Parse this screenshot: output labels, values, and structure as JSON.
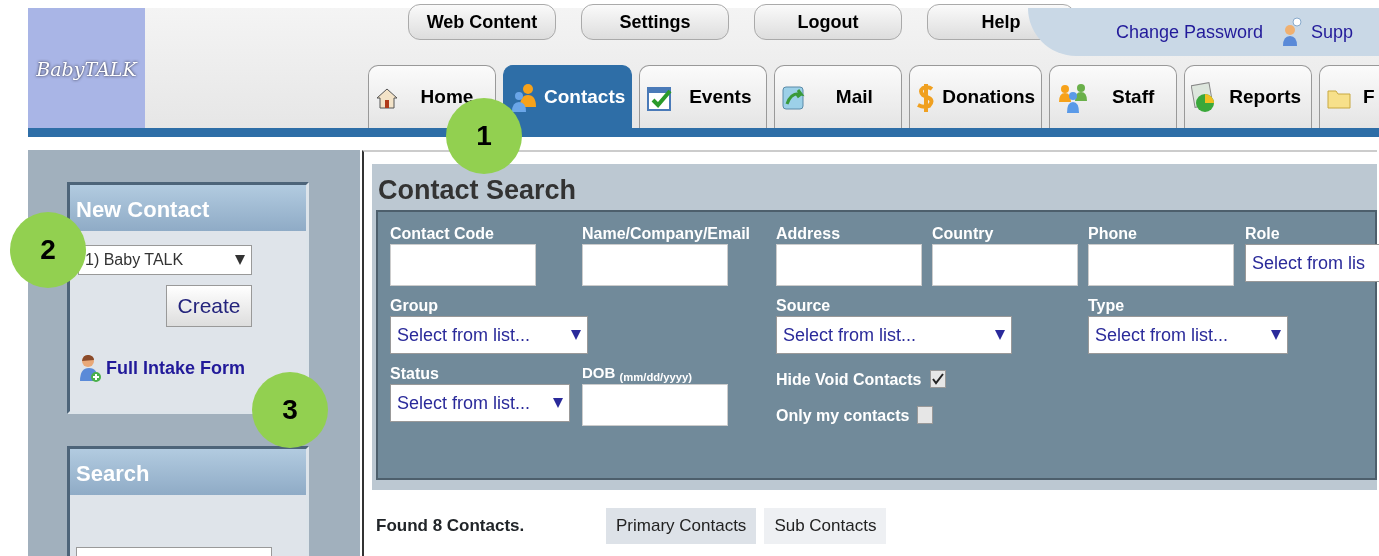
{
  "logo": {
    "text": "BabyTALK"
  },
  "top_buttons": [
    "Web Content",
    "Settings",
    "Logout",
    "Help"
  ],
  "account_links": [
    {
      "label": "Change Password",
      "kind": "link"
    },
    {
      "label": "Supp",
      "kind": "support"
    }
  ],
  "tabs": [
    {
      "label": "Home",
      "kind": "home",
      "selected": false
    },
    {
      "label": "Contacts",
      "kind": "people",
      "selected": true
    },
    {
      "label": "Events",
      "kind": "calendar",
      "selected": false
    },
    {
      "label": "Mail",
      "kind": "mail",
      "selected": false
    },
    {
      "label": "Donations",
      "kind": "dollar",
      "selected": false
    },
    {
      "label": "Staff",
      "kind": "staff",
      "selected": false
    },
    {
      "label": "Reports",
      "kind": "chart",
      "selected": false
    },
    {
      "label": "F",
      "kind": "folder",
      "selected": false
    }
  ],
  "sidebar": {
    "new_contact": {
      "title": "New Contact",
      "select_value": "1) Baby TALK",
      "button": "Create",
      "link": "Full Intake Form"
    },
    "search": {
      "title": "Search"
    }
  },
  "contact_search": {
    "title": "Contact Search",
    "fields": [
      {
        "label": "Contact Code",
        "kind": "text"
      },
      {
        "label": "Name/Company/Email",
        "kind": "text"
      },
      {
        "label": "Address",
        "kind": "text"
      },
      {
        "label": "Country",
        "kind": "text"
      },
      {
        "label": "Phone",
        "kind": "text"
      },
      {
        "label": "Role",
        "kind": "select",
        "value": "Select from lis"
      },
      {
        "label": "Group",
        "kind": "select",
        "value": "Select from list..."
      },
      {
        "label": "Source",
        "kind": "select",
        "value": "Select from list..."
      },
      {
        "label": "Type",
        "kind": "select",
        "value": "Select from list..."
      },
      {
        "label": "Status",
        "kind": "select",
        "value": "Select from list..."
      },
      {
        "label": "DOB $_{(mm/dd/yyyy)}$",
        "kind": "text"
      }
    ],
    "checks": [
      {
        "label": "Hide Void Contacts",
        "checked": true
      },
      {
        "label": "Only my contacts",
        "checked": false
      }
    ]
  },
  "results": {
    "found": "Found 8 Contacts.",
    "subtabs": [
      {
        "label": "Primary Contacts",
        "selected": true
      },
      {
        "label": "Sub Contacts",
        "selected": false
      }
    ]
  },
  "callouts": [
    "1",
    "2",
    "3"
  ]
}
